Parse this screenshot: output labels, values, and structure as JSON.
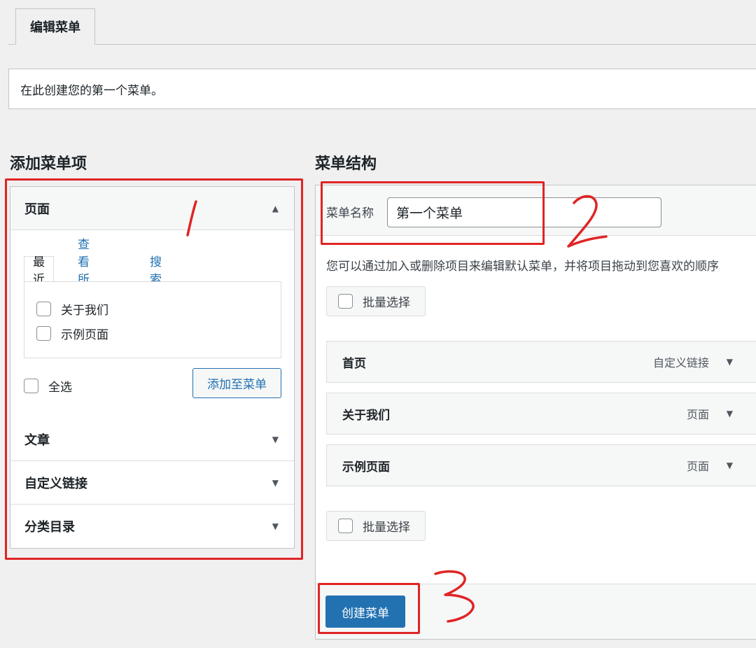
{
  "tabs": {
    "active_label": "编辑菜单"
  },
  "notice": {
    "text": "在此创建您的第一个菜单。"
  },
  "left": {
    "heading": "添加菜单项",
    "sections": [
      {
        "label": "页面",
        "expanded": true
      },
      {
        "label": "文章",
        "expanded": false
      },
      {
        "label": "自定义链接",
        "expanded": false
      },
      {
        "label": "分类目录",
        "expanded": false
      }
    ],
    "subtabs": [
      "最近",
      "查看所有",
      "搜索"
    ],
    "items": [
      "关于我们",
      "示例页面"
    ],
    "select_all": "全选",
    "add_button": "添加至菜单"
  },
  "right": {
    "heading": "菜单结构",
    "name_label": "菜单名称",
    "name_value": "第一个菜单",
    "description": "您可以通过加入或删除项目来编辑默认菜单，并将项目拖动到您喜欢的顺序",
    "bulk_select": "批量选择",
    "menu_items": [
      {
        "title": "首页",
        "type": "自定义链接"
      },
      {
        "title": "关于我们",
        "type": "页面"
      },
      {
        "title": "示例页面",
        "type": "页面"
      }
    ],
    "create_button": "创建菜单"
  },
  "annotations": [
    "1",
    "2",
    "3"
  ],
  "colors": {
    "accent": "#2271b1",
    "annotation": "#e02424"
  }
}
